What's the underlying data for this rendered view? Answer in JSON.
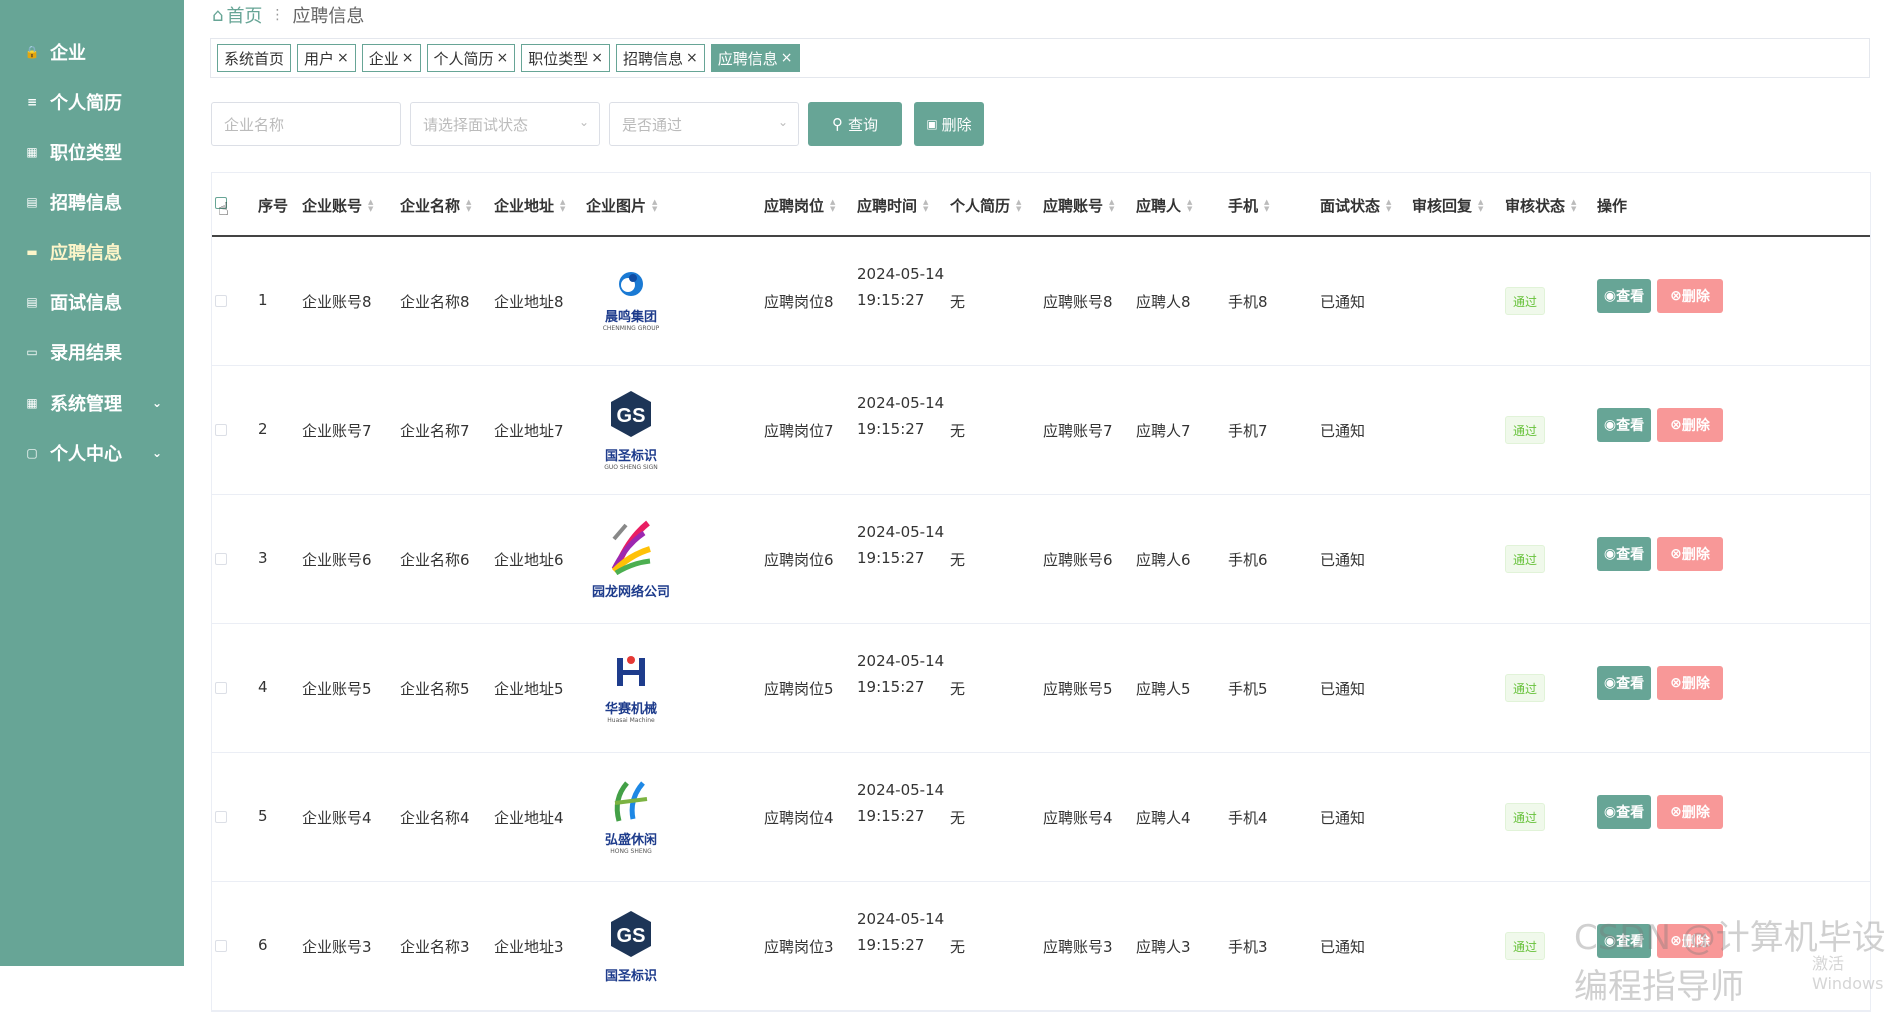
{
  "sidebar": {
    "items": [
      {
        "label": "企业",
        "icon": "lock-icon"
      },
      {
        "label": "个人简历",
        "icon": "list-icon"
      },
      {
        "label": "职位类型",
        "icon": "grid-icon"
      },
      {
        "label": "招聘信息",
        "icon": "clipboard-icon"
      },
      {
        "label": "应聘信息",
        "icon": "message-icon",
        "active": true
      },
      {
        "label": "面试信息",
        "icon": "clipboard-icon"
      },
      {
        "label": "录用结果",
        "icon": "monitor-icon"
      },
      {
        "label": "系统管理",
        "icon": "grid-icon"
      },
      {
        "label": "个人中心",
        "icon": "document-icon"
      }
    ]
  },
  "breadcrumb": {
    "home": "首页",
    "current": "应聘信息"
  },
  "tags": [
    "系统首页",
    "用户",
    "企业",
    "个人简历",
    "职位类型",
    "招聘信息",
    "应聘信息"
  ],
  "search": {
    "company_placeholder": "企业名称",
    "interview_placeholder": "请选择面试状态",
    "pass_placeholder": "是否通过",
    "query_label": "查询",
    "delete_label": "删除"
  },
  "table": {
    "headers": [
      "序号",
      "企业账号",
      "企业名称",
      "企业地址",
      "企业图片",
      "应聘岗位",
      "应聘时间",
      "个人简历",
      "应聘账号",
      "应聘人",
      "手机",
      "面试状态",
      "审核回复",
      "审核状态",
      "操作"
    ],
    "view_label": "查看",
    "delete_label": "删除",
    "rows": [
      {
        "idx": "1",
        "account": "企业账号8",
        "name": "企业名称8",
        "address": "企业地址8",
        "logo_text": "晨鸣集团",
        "logo_sub": "CHENMING GROUP",
        "position": "应聘岗位8",
        "date": "2024-05-14",
        "time": "19:15:27",
        "resume": "无",
        "applicant_account": "应聘账号8",
        "applicant": "应聘人8",
        "phone": "手机8",
        "interview": "已通知",
        "reply": "",
        "status": "通过"
      },
      {
        "idx": "2",
        "account": "企业账号7",
        "name": "企业名称7",
        "address": "企业地址7",
        "logo_text": "国圣标识",
        "logo_sub": "GUO SHENG SIGN",
        "position": "应聘岗位7",
        "date": "2024-05-14",
        "time": "19:15:27",
        "resume": "无",
        "applicant_account": "应聘账号7",
        "applicant": "应聘人7",
        "phone": "手机7",
        "interview": "已通知",
        "reply": "",
        "status": "通过"
      },
      {
        "idx": "3",
        "account": "企业账号6",
        "name": "企业名称6",
        "address": "企业地址6",
        "logo_text": "园龙网络公司",
        "logo_sub": "",
        "position": "应聘岗位6",
        "date": "2024-05-14",
        "time": "19:15:27",
        "resume": "无",
        "applicant_account": "应聘账号6",
        "applicant": "应聘人6",
        "phone": "手机6",
        "interview": "已通知",
        "reply": "",
        "status": "通过"
      },
      {
        "idx": "4",
        "account": "企业账号5",
        "name": "企业名称5",
        "address": "企业地址5",
        "logo_text": "华赛机械",
        "logo_sub": "Huasai Machine",
        "position": "应聘岗位5",
        "date": "2024-05-14",
        "time": "19:15:27",
        "resume": "无",
        "applicant_account": "应聘账号5",
        "applicant": "应聘人5",
        "phone": "手机5",
        "interview": "已通知",
        "reply": "",
        "status": "通过"
      },
      {
        "idx": "5",
        "account": "企业账号4",
        "name": "企业名称4",
        "address": "企业地址4",
        "logo_text": "弘盛休闲",
        "logo_sub": "HONG SHENG",
        "position": "应聘岗位4",
        "date": "2024-05-14",
        "time": "19:15:27",
        "resume": "无",
        "applicant_account": "应聘账号4",
        "applicant": "应聘人4",
        "phone": "手机4",
        "interview": "已通知",
        "reply": "",
        "status": "通过"
      },
      {
        "idx": "6",
        "account": "企业账号3",
        "name": "企业名称3",
        "address": "企业地址3",
        "logo_text": "国圣标识",
        "logo_sub": "",
        "position": "应聘岗位3",
        "date": "2024-05-14",
        "time": "19:15:27",
        "resume": "无",
        "applicant_account": "应聘账号3",
        "applicant": "应聘人3",
        "phone": "手机3",
        "interview": "已通知",
        "reply": "",
        "status": "通过"
      }
    ]
  },
  "watermark": "CSDN @计算机毕设编程指导师",
  "watermark2": "激活 Windows",
  "colors": {
    "primary": "#67a596",
    "danger": "#f89898",
    "success_bg": "#f0f9eb",
    "success_text": "#67c23a"
  }
}
